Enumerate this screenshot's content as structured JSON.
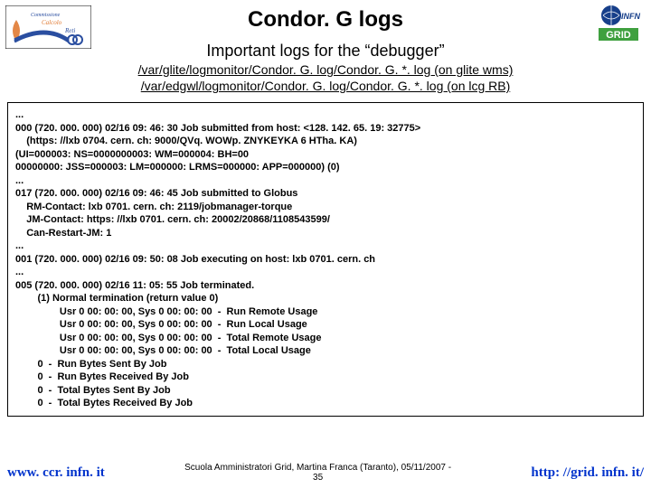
{
  "title": "Condor. G logs",
  "subtitle": "Important logs for the “debugger”",
  "path1": "/var/glite/logmonitor/Condor. G. log/Condor. G. *. log (on glite wms)",
  "path2": "/var/edgwl/logmonitor/Condor. G. log/Condor. G. *. log (on lcg RB)",
  "log": [
    "...",
    "000 (720. 000. 000) 02/16 09: 46: 30 Job submitted from host: <128. 142. 65. 19: 32775>",
    "    (https: //lxb 0704. cern. ch: 9000/QVq. WOWp. ZNYKEYKA 6 HTha. KA)",
    "(UI=000003: NS=0000000003: WM=000004: BH=00",
    "00000000: JSS=000003: LM=000000: LRMS=000000: APP=000000) (0)",
    "...",
    "017 (720. 000. 000) 02/16 09: 46: 45 Job submitted to Globus",
    "    RM-Contact: lxb 0701. cern. ch: 2119/jobmanager-torque",
    "    JM-Contact: https: //lxb 0701. cern. ch: 20002/20868/1108543599/",
    "    Can-Restart-JM: 1",
    "...",
    "001 (720. 000. 000) 02/16 09: 50: 08 Job executing on host: lxb 0701. cern. ch",
    "...",
    "005 (720. 000. 000) 02/16 11: 05: 55 Job terminated.",
    "        (1) Normal termination (return value 0)",
    "                Usr 0 00: 00: 00, Sys 0 00: 00: 00  -  Run Remote Usage",
    "                Usr 0 00: 00: 00, Sys 0 00: 00: 00  -  Run Local Usage",
    "                Usr 0 00: 00: 00, Sys 0 00: 00: 00  -  Total Remote Usage",
    "                Usr 0 00: 00: 00, Sys 0 00: 00: 00  -  Total Local Usage",
    "        0  -  Run Bytes Sent By Job",
    "        0  -  Run Bytes Received By Job",
    "        0  -  Total Bytes Sent By Job",
    "        0  -  Total Bytes Received By Job"
  ],
  "footer": {
    "left": "www. ccr. infn. it",
    "midTop": "Scuola Amministratori Grid, Martina Franca (Taranto), 05/11/2007  -",
    "midNum": "35",
    "right": "http: //grid. infn. it/"
  },
  "colors": {
    "ccr_orange": "#e07a32",
    "ccr_blue": "#2a4ea0",
    "infn_blue": "#173f8a",
    "grid_green": "#3fa03f"
  }
}
